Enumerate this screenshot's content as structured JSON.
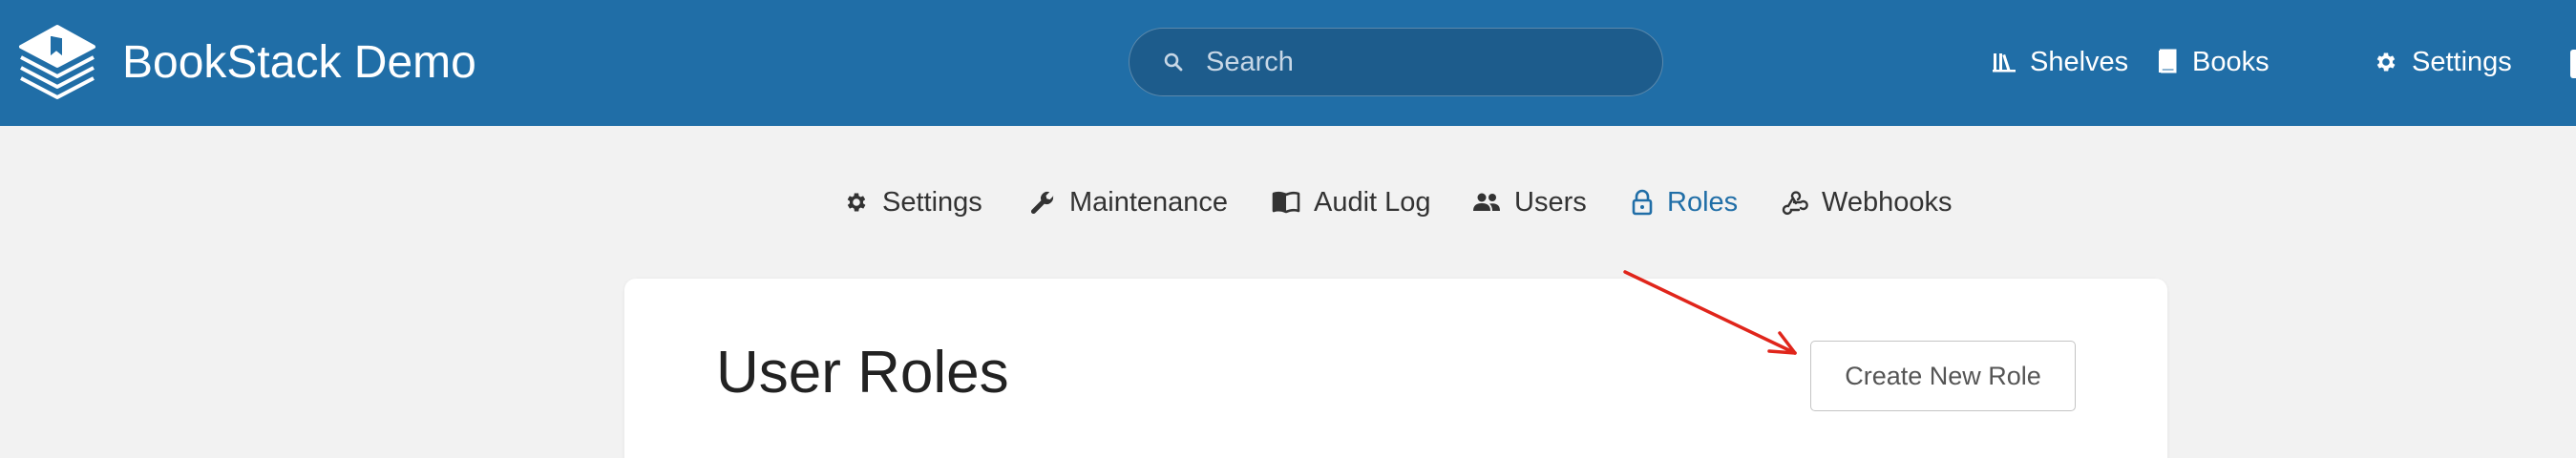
{
  "header": {
    "site_title": "BookStack Demo",
    "logo_icon": "bookstack-logo-icon",
    "search": {
      "placeholder": "Search",
      "value": "",
      "icon": "search-icon"
    },
    "nav": [
      {
        "label": "Shelves",
        "icon": "shelves-icon"
      },
      {
        "label": "Books",
        "icon": "book-icon"
      },
      {
        "label": "Settings",
        "icon": "gear-icon"
      }
    ],
    "background_color": "#206ea7"
  },
  "settings_nav": {
    "items": [
      {
        "label": "Settings",
        "icon": "gear-icon",
        "active": false
      },
      {
        "label": "Maintenance",
        "icon": "wrench-icon",
        "active": false
      },
      {
        "label": "Audit Log",
        "icon": "open-book-icon",
        "active": false
      },
      {
        "label": "Users",
        "icon": "users-icon",
        "active": false
      },
      {
        "label": "Roles",
        "icon": "lock-icon",
        "active": true
      },
      {
        "label": "Webhooks",
        "icon": "webhook-icon",
        "active": false
      }
    ],
    "active_color": "#206ea7"
  },
  "main": {
    "title": "User Roles",
    "create_button_label": "Create New Role"
  },
  "annotation": {
    "arrow_color": "#e0251b"
  }
}
